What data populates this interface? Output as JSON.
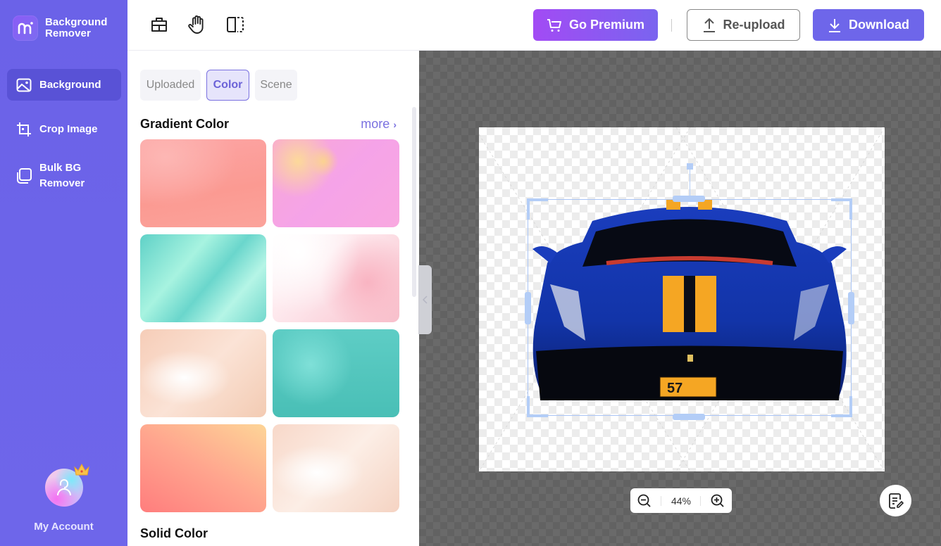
{
  "brand": {
    "line1": "Background",
    "line2": "Remover"
  },
  "sidebar": {
    "items": [
      {
        "label": "Background",
        "icon": "image-icon",
        "active": true
      },
      {
        "label": "Crop Image",
        "icon": "crop-icon",
        "active": false
      },
      {
        "label_line1": "Bulk BG",
        "label_line2": "Remover",
        "icon": "layers-icon",
        "active": false
      }
    ],
    "account_label": "My Account"
  },
  "toolbar": {
    "tools": [
      "erase-restore-icon",
      "hand-pan-icon",
      "compare-icon"
    ],
    "premium_label": "Go Premium",
    "reupload_label": "Re-upload",
    "download_label": "Download"
  },
  "panel": {
    "tabs": [
      {
        "label": "Uploaded",
        "active": false
      },
      {
        "label": "Color",
        "active": true
      },
      {
        "label": "Scene",
        "active": false
      }
    ],
    "gradient_title": "Gradient Color",
    "more_label": "more",
    "solid_title": "Solid Color",
    "swatches": [
      "coral-wave",
      "pink-bokeh",
      "mint-silk",
      "pink-cloud",
      "peach-watercolor",
      "teal-sparkle",
      "coral-peach",
      "peach-cloud"
    ]
  },
  "canvas": {
    "zoom_level": "44%",
    "plate_number": "57",
    "colors": {
      "accent": "#6e66ea",
      "premium_start": "#a24bf4",
      "selection": "#b3cdf7"
    }
  }
}
